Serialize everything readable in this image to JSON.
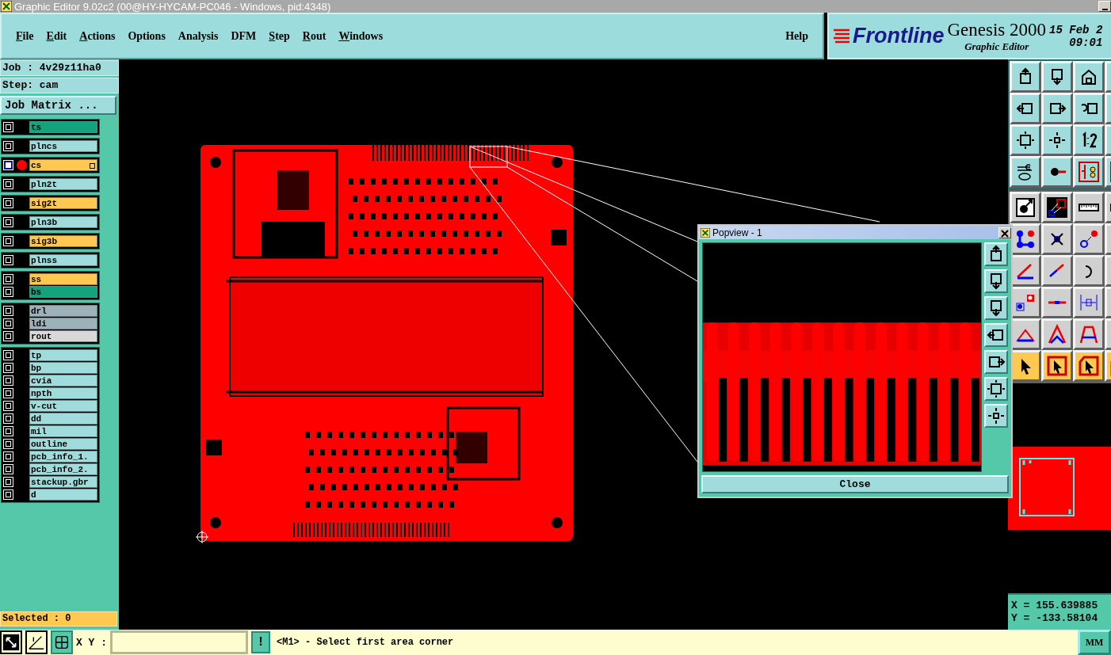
{
  "window": {
    "title": "Graphic Editor 9.02c2 (00@HY-HYCAM-PC046 - Windows, pid:4348)"
  },
  "menu": [
    {
      "label": "File",
      "mnemonic": true
    },
    {
      "label": "Edit",
      "mnemonic": true
    },
    {
      "label": "Actions",
      "mnemonic": true
    },
    {
      "label": "Options",
      "mnemonic": false
    },
    {
      "label": "Analysis",
      "mnemonic": false
    },
    {
      "label": "DFM",
      "mnemonic": false
    },
    {
      "label": "Step",
      "mnemonic": true
    },
    {
      "label": "Rout",
      "mnemonic": true
    },
    {
      "label": "Windows",
      "mnemonic": true
    }
  ],
  "help": "Help",
  "brand": {
    "logo": "Frontline",
    "product": "Genesis 2000",
    "subtitle": "Graphic Editor",
    "date": "15 Feb 2",
    "time": "09:01"
  },
  "job": {
    "job": "Job : 4v29z11ha0",
    "step": "Step: cam",
    "matrix_button": "Job Matrix ..."
  },
  "layer_groups": [
    {
      "layers": [
        {
          "name": "ts",
          "color": "#12a47c",
          "selected": false
        }
      ]
    },
    {
      "layers": [
        {
          "name": "plncs",
          "color": "#a0dcdc",
          "selected": false
        }
      ]
    },
    {
      "layers": [
        {
          "name": "cs",
          "color": "#ffc850",
          "selected": true
        }
      ]
    },
    {
      "layers": [
        {
          "name": "pln2t",
          "color": "#a0dcdc",
          "selected": false
        }
      ]
    },
    {
      "layers": [
        {
          "name": "sig2t",
          "color": "#ffc850",
          "selected": false
        }
      ]
    },
    {
      "layers": [
        {
          "name": "pln3b",
          "color": "#a0dcdc",
          "selected": false
        }
      ]
    },
    {
      "layers": [
        {
          "name": "sig3b",
          "color": "#ffc850",
          "selected": false
        }
      ]
    },
    {
      "layers": [
        {
          "name": "plnss",
          "color": "#a0dcdc",
          "selected": false
        }
      ]
    },
    {
      "layers": [
        {
          "name": "ss",
          "color": "#ffc850",
          "selected": false
        },
        {
          "name": "bs",
          "color": "#12a47c",
          "selected": false
        }
      ]
    },
    {
      "layers": [
        {
          "name": "drl",
          "color": "#9eb0b8",
          "selected": false
        },
        {
          "name": "ldi",
          "color": "#9eb0b8",
          "selected": false
        },
        {
          "name": "rout",
          "color": "#d8d8d8",
          "selected": false
        }
      ]
    },
    {
      "layers": [
        {
          "name": "tp",
          "color": "#a0dcdc",
          "selected": false
        },
        {
          "name": "bp",
          "color": "#a0dcdc",
          "selected": false
        },
        {
          "name": "cvia",
          "color": "#a0dcdc",
          "selected": false
        },
        {
          "name": "npth",
          "color": "#a0dcdc",
          "selected": false
        },
        {
          "name": "v-cut",
          "color": "#a0dcdc",
          "selected": false
        },
        {
          "name": "dd",
          "color": "#a0dcdc",
          "selected": false
        },
        {
          "name": "mil",
          "color": "#a0dcdc",
          "selected": false
        },
        {
          "name": "outline",
          "color": "#a0dcdc",
          "selected": false
        },
        {
          "name": "pcb_info_1.",
          "color": "#a0dcdc",
          "selected": false
        },
        {
          "name": "pcb_info_2.",
          "color": "#a0dcdc",
          "selected": false
        },
        {
          "name": "stackup.gbr",
          "color": "#a0dcdc",
          "selected": false
        },
        {
          "name": "d",
          "color": "#a0dcdc",
          "selected": false
        }
      ]
    }
  ],
  "selected_count": "Selected : 0",
  "popview": {
    "title": "Popview - 1",
    "close": "Close"
  },
  "readout": {
    "x": "X = 155.639885",
    "y": "Y = -133.58104"
  },
  "command": {
    "label": "X Y :",
    "alert": "!",
    "message": "<M1> - Select first area corner",
    "units": "MM"
  }
}
